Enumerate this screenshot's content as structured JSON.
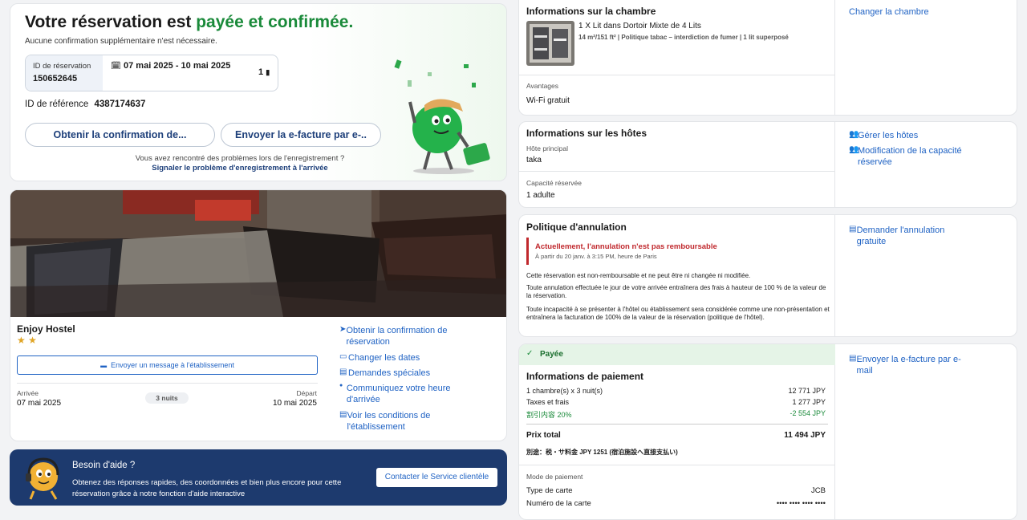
{
  "confirmation": {
    "title_prefix": "Votre réservation est ",
    "title_highlight": "payée et confirmée.",
    "subtitle": "Aucune confirmation supplémentaire n'est nécessaire.",
    "booking_id_label": "ID de réservation",
    "booking_id": "150652645",
    "dates": "07 mai 2025 - 10 mai 2025",
    "room_count": "1",
    "reference_label": "ID de référence",
    "reference_id": "4387174637",
    "btn_get_confirmation": "Obtenir la confirmation de...",
    "btn_send_invoice": "Envoyer la e-facture par e-..",
    "problem_text": "Vous avez rencontré des problèmes lors de l'enregistrement ?",
    "problem_link": "Signaler le problème d'enregistrement à l'arrivée"
  },
  "hotel": {
    "name": "Enjoy Hostel",
    "stars": "★ ★",
    "message_btn": "Envoyer un message à l'établissement",
    "arrival_label": "Arrivée",
    "arrival_date": "07 mai 2025",
    "nights": "3 nuits",
    "departure_label": "Départ",
    "departure_date": "10 mai 2025",
    "actions": [
      {
        "icon": "➤",
        "label": "Obtenir la confirmation de réservation"
      },
      {
        "icon": "▭",
        "label": "Changer les dates"
      },
      {
        "icon": "▤",
        "label": "Demandes spéciales"
      },
      {
        "icon": "●",
        "label": "Communiquez votre heure d'arrivée"
      },
      {
        "icon": "▤",
        "label": "Voir les conditions de l'établissement"
      }
    ]
  },
  "help": {
    "title": "Besoin d'aide ?",
    "text": "Obtenez des réponses rapides, des coordonnées et bien plus encore pour cette réservation grâce à notre fonction d'aide interactive",
    "button": "Contacter le Service clientèle"
  },
  "room": {
    "title": "Informations sur la chambre",
    "name": "1 X Lit dans Dortoir Mixte de 4 Lits",
    "details": "14 m²/151 ft² | Politique tabac – interdiction de fumer | 1 lit superposé",
    "change_link": "Changer la chambre",
    "benefits_label": "Avantages",
    "benefit": "Wi-Fi gratuit"
  },
  "guests": {
    "title": "Informations sur les hôtes",
    "main_guest_label": "Hôte principal",
    "main_guest": "taka",
    "capacity_label": "Capacité réservée",
    "capacity": "1 adulte",
    "manage_link": "Gérer les hôtes",
    "modify_link": "Modification de la capacité réservée"
  },
  "cancellation": {
    "title": "Politique d'annulation",
    "alert_title": "Actuellement, l'annulation n'est pas remboursable",
    "alert_sub": "À partir du 20 janv. à 3:15 PM, heure de Paris",
    "p1": "Cette réservation est non-remboursable et ne peut être ni changée ni modifiée.",
    "p2": "Toute annulation effectuée le jour de votre arrivée entraînera des frais à hauteur de 100 % de la valeur de la réservation.",
    "p3": "Toute incapacité à se présenter à l'hôtel ou établissement sera considérée comme une non-présentation et entraînera la facturation de 100% de la valeur de la réservation (politique de l'hôtel).",
    "request_link": "Demander l'annulation gratuite"
  },
  "payment": {
    "status": "Payée",
    "title": "Informations de paiement",
    "rows": [
      {
        "label": "1 chambre(s) x 3 nuit(s)",
        "value": "12 771 JPY"
      },
      {
        "label": "Taxes et frais",
        "value": "1 277 JPY"
      },
      {
        "label": "割引内容 20%",
        "value": "-2 554 JPY"
      }
    ],
    "total_label": "Prix total",
    "total_value": "11 494 JPY",
    "extra": "別途：税・サ料金 JPY 1251 (宿泊施設へ直接支払い)",
    "method_label": "Mode de paiement",
    "card_type_label": "Type de carte",
    "card_type": "JCB",
    "card_number_label": "Numéro de la carte",
    "card_number": "•••• •••• •••• ••••",
    "invoice_link": "Envoyer la e-facture par e-mail"
  },
  "colors": {
    "accent_green": "#1a8a3a",
    "link_blue": "#2063c4",
    "help_bg": "#1d3a6e",
    "alert_red": "#c0282d"
  }
}
